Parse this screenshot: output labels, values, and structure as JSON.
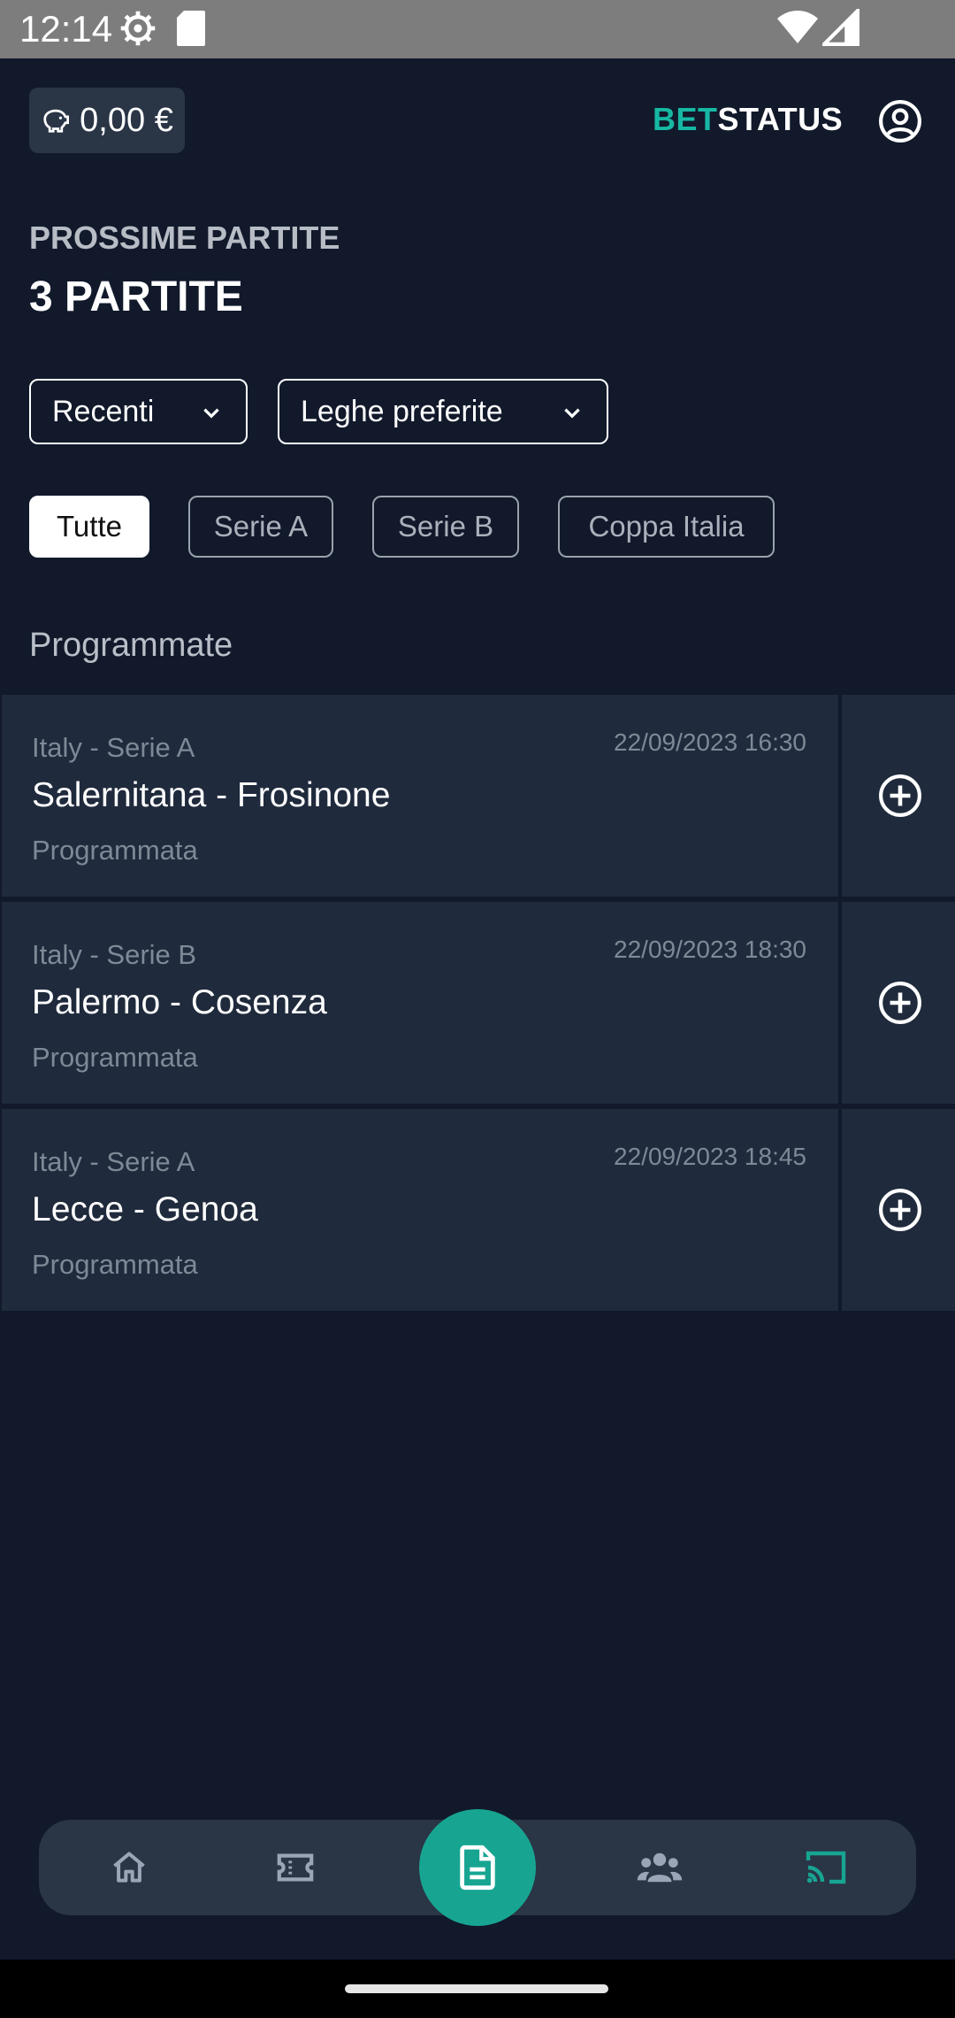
{
  "status_bar": {
    "time": "12:14"
  },
  "header": {
    "balance": "0,00 €",
    "logo_bet": "BET",
    "logo_status": "STATUS"
  },
  "page": {
    "subtitle": "PROSSIME PARTITE",
    "title": "3 PARTITE"
  },
  "filters": {
    "sort_selected": "Recenti",
    "league_selected": "Leghe preferite"
  },
  "chips": [
    {
      "label": "Tutte",
      "active": true
    },
    {
      "label": "Serie A",
      "active": false
    },
    {
      "label": "Serie B",
      "active": false
    },
    {
      "label": "Coppa Italia",
      "active": false
    }
  ],
  "section": {
    "label": "Programmate"
  },
  "matches": [
    {
      "league": "Italy - Serie A",
      "datetime": "22/09/2023 16:30",
      "teams": "Salernitana - Frosinone",
      "status": "Programmata"
    },
    {
      "league": "Italy - Serie B",
      "datetime": "22/09/2023 18:30",
      "teams": "Palermo - Cosenza",
      "status": "Programmata"
    },
    {
      "league": "Italy - Serie A",
      "datetime": "22/09/2023 18:45",
      "teams": "Lecce - Genoa",
      "status": "Programmata"
    }
  ],
  "bottom_nav": {
    "items": [
      {
        "icon": "home-icon"
      },
      {
        "icon": "ticket-icon"
      },
      {
        "icon": "document-icon",
        "active": true
      },
      {
        "icon": "group-icon"
      },
      {
        "icon": "cast-icon"
      }
    ]
  },
  "colors": {
    "background": "#11192b",
    "card": "#1f2a3c",
    "accent": "#17a592",
    "logo_accent": "#17b8a3"
  }
}
